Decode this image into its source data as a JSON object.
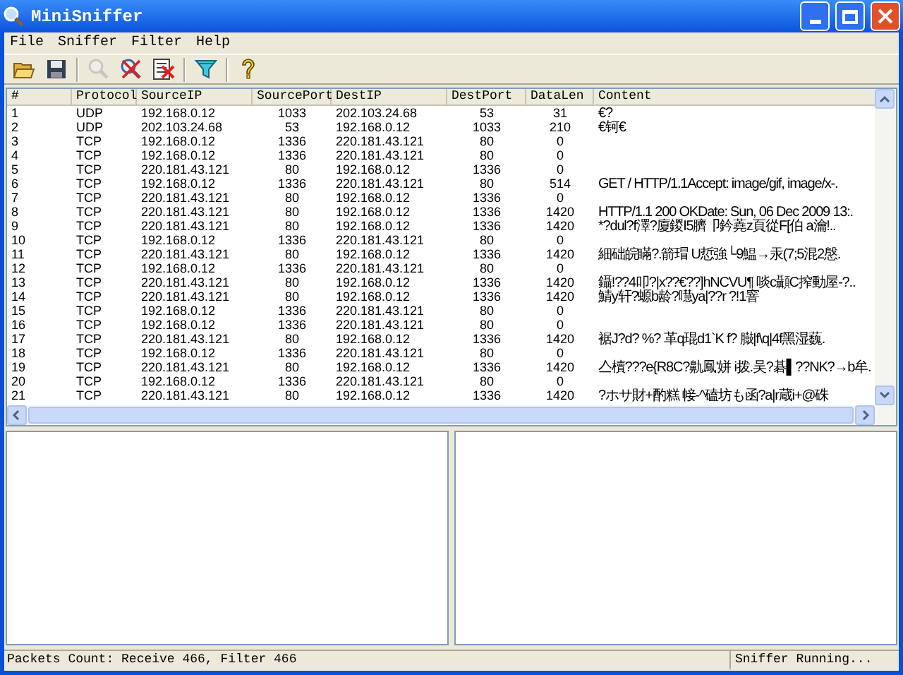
{
  "window": {
    "title": "MiniSniffer"
  },
  "menu": [
    "File",
    "Sniffer",
    "Filter",
    "Help"
  ],
  "toolbar": [
    {
      "kind": "open",
      "disabled": false
    },
    {
      "kind": "save",
      "disabled": false
    },
    {
      "kind": "sep"
    },
    {
      "kind": "search",
      "disabled": true
    },
    {
      "kind": "stop",
      "disabled": false
    },
    {
      "kind": "clear",
      "disabled": false
    },
    {
      "kind": "sep"
    },
    {
      "kind": "filter",
      "disabled": false
    },
    {
      "kind": "sep"
    },
    {
      "kind": "help",
      "disabled": false
    }
  ],
  "table": {
    "columns": [
      "#",
      "Protocol",
      "SourceIP",
      "SourcePort",
      "DestIP",
      "DestPort",
      "DataLen",
      "Content"
    ],
    "rows": [
      [
        "1",
        "UDP",
        "192.168.0.12",
        "1033",
        "202.103.24.68",
        "53",
        "31",
        "€?"
      ],
      [
        "2",
        "UDP",
        "202.103.24.68",
        "53",
        "192.168.0.12",
        "1033",
        "210",
        "€钶€"
      ],
      [
        "3",
        "TCP",
        "192.168.0.12",
        "1336",
        "220.181.43.121",
        "80",
        "0",
        ""
      ],
      [
        "4",
        "TCP",
        "192.168.0.12",
        "1336",
        "220.181.43.121",
        "80",
        "0",
        ""
      ],
      [
        "5",
        "TCP",
        "220.181.43.121",
        "80",
        "192.168.0.12",
        "1336",
        "0",
        ""
      ],
      [
        "6",
        "TCP",
        "192.168.0.12",
        "1336",
        "220.181.43.121",
        "80",
        "514",
        "GET / HTTP/1.1Accept: image/gif, image/x-."
      ],
      [
        "7",
        "TCP",
        "220.181.43.121",
        "80",
        "192.168.0.12",
        "1336",
        "0",
        ""
      ],
      [
        "8",
        "TCP",
        "220.181.43.121",
        "80",
        "192.168.0.12",
        "1336",
        "1420",
        "HTTP/1.1 200 OKDate: Sun, 06 Dec 2009 13:."
      ],
      [
        "9",
        "TCP",
        "220.181.43.121",
        "80",
        "192.168.0.12",
        "1336",
        "1420",
        "*?dul?f澤?廈鍐I5臍卩鈐蕘z頁從F[伯 a瀹!.."
      ],
      [
        "10",
        "TCP",
        "192.168.0.12",
        "1336",
        "220.181.43.121",
        "80",
        "0",
        ""
      ],
      [
        "11",
        "TCP",
        "220.181.43.121",
        "80",
        "192.168.0.12",
        "1336",
        "1420",
        "  細础皖瞞?.箭瑁 U悊強└9鰛→汞(7;5混2慇."
      ],
      [
        "12",
        "TCP",
        "192.168.0.12",
        "1336",
        "220.181.43.121",
        "80",
        "0",
        ""
      ],
      [
        "13",
        "TCP",
        "220.181.43.121",
        "80",
        "192.168.0.12",
        "1336",
        "1420",
        "鑷!??4叩?|x??€??]hNCVU¶ 啖c顳C搾動屋-?.."
      ],
      [
        "14",
        "TCP",
        "220.181.43.121",
        "80",
        "192.168.0.12",
        "1336",
        "1420",
        "鯖y轩?螈b龄?嚖ya|??r ?!1窨"
      ],
      [
        "15",
        "TCP",
        "192.168.0.12",
        "1336",
        "220.181.43.121",
        "80",
        "0",
        ""
      ],
      [
        "16",
        "TCP",
        "192.168.0.12",
        "1336",
        "220.181.43.121",
        "80",
        "0",
        ""
      ],
      [
        "17",
        "TCP",
        "220.181.43.121",
        "80",
        "192.168.0.12",
        "1336",
        "1420",
        "裾J?d? %? 革q琨d1`K f? 臌|f\\q|4f黑湿蘶."
      ],
      [
        "18",
        "TCP",
        "192.168.0.12",
        "1336",
        "220.181.43.121",
        "80",
        "0",
        ""
      ],
      [
        "19",
        "TCP",
        "220.181.43.121",
        "80",
        "192.168.0.12",
        "1336",
        "1420",
        "亼櫝???e{R8C?鼽鳳'姘 i拨.吴?碁▌??NK?→b牟."
      ],
      [
        "20",
        "TCP",
        "192.168.0.12",
        "1336",
        "220.181.43.121",
        "80",
        "0",
        ""
      ],
      [
        "21",
        "TCP",
        "220.181.43.121",
        "80",
        "192.168.0.12",
        "1336",
        "1420",
        "?ホサ財+酌糕 帹-^磕坊も函?a|r蔵i+@硃"
      ]
    ]
  },
  "status_bar": [
    "Packets Count: Receive 466, Filter 466",
    "Sniffer Running..."
  ]
}
